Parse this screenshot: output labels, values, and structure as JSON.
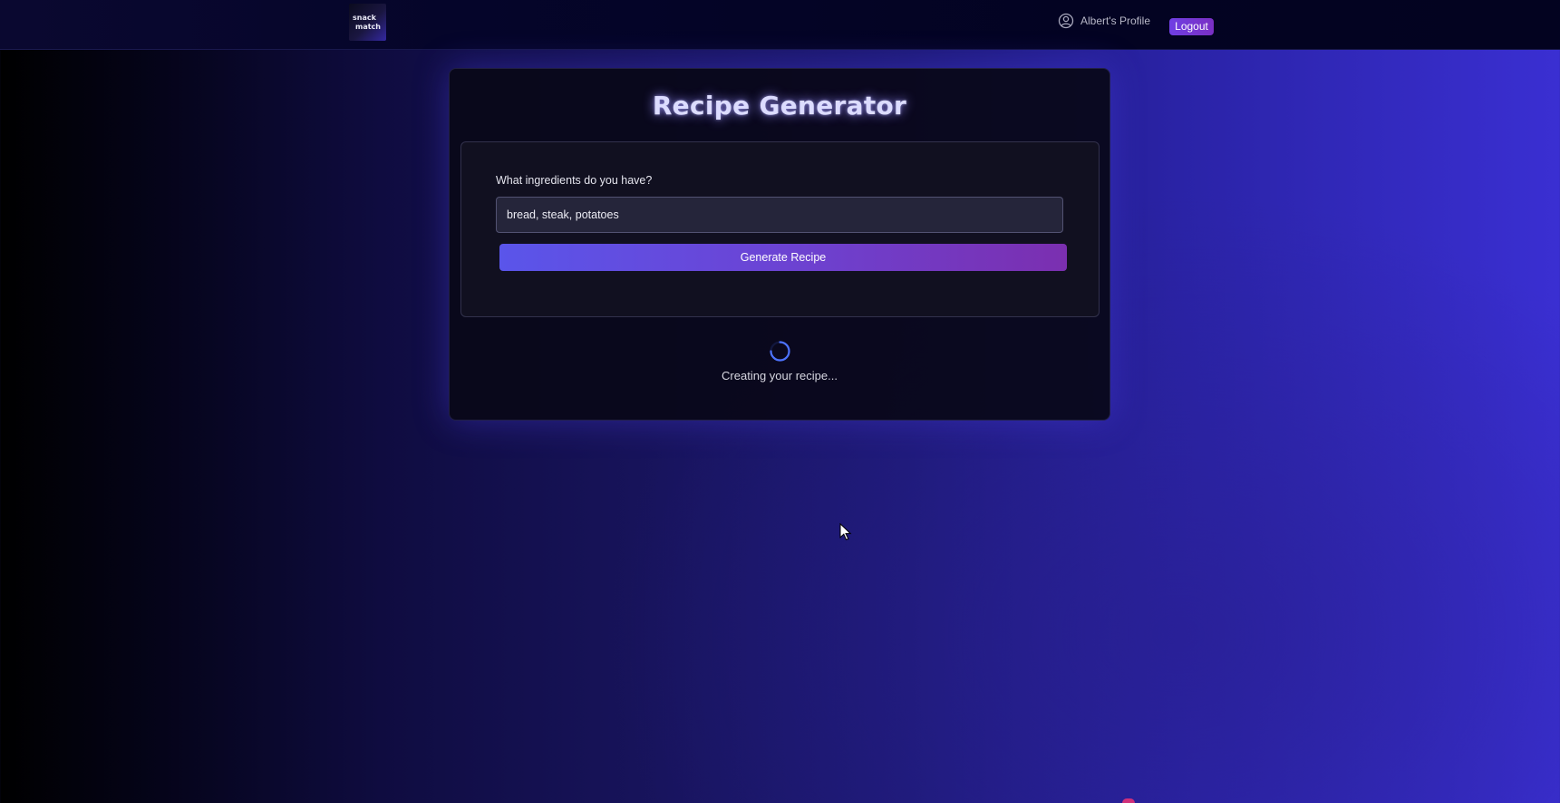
{
  "header": {
    "logo": {
      "icon": "snack-match-logo-icon",
      "text": "snack match"
    },
    "profile": {
      "icon": "user-circle-icon",
      "label": "Albert's Profile"
    },
    "logout_label": "Logout"
  },
  "card": {
    "title": "Recipe Generator",
    "form": {
      "label": "What ingredients do you have?",
      "input_value": "bread, steak, potatoes",
      "button_label": "Generate Recipe"
    },
    "loading": {
      "icon": "loading-spinner-icon",
      "text": "Creating your recipe..."
    }
  },
  "colors": {
    "accent": "#5a55ea",
    "accent_end": "#7b2fb0",
    "logout_bg": "#6f3fe3",
    "spinner": "#4d73ff",
    "card_bg": "#090818"
  }
}
